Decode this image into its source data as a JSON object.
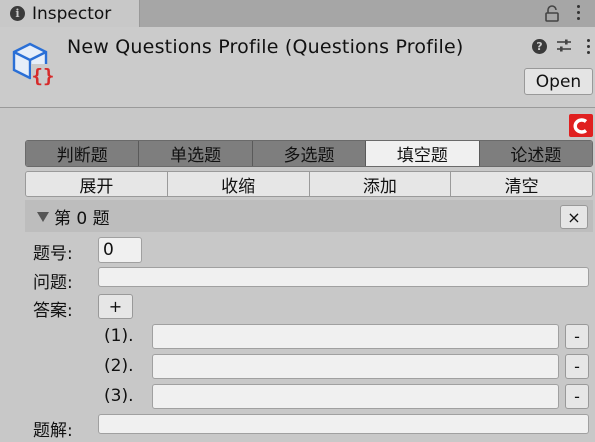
{
  "tab": {
    "title": "Inspector"
  },
  "header": {
    "title": "New Questions Profile (Questions Profile)",
    "open_label": "Open"
  },
  "question_types": [
    "判断题",
    "单选题",
    "多选题",
    "填空题",
    "论述题"
  ],
  "active_type_index": 3,
  "actions": [
    "展开",
    "收缩",
    "添加",
    "清空"
  ],
  "question": {
    "title": "第 0 题",
    "close_label": "×",
    "number_label": "题号:",
    "number_value": "0",
    "question_label": "问题:",
    "question_value": "",
    "answer_label": "答案:",
    "add_label": "+",
    "answers": [
      {
        "index": "(1).",
        "value": "",
        "remove": "-"
      },
      {
        "index": "(2).",
        "value": "",
        "remove": "-"
      },
      {
        "index": "(3).",
        "value": "",
        "remove": "-"
      }
    ],
    "solution_label": "题解:",
    "solution_value": ""
  },
  "colors": {
    "accent_red": "#e02020",
    "asset_blue": "#2a6fd6",
    "asset_red": "#d62a2a"
  }
}
